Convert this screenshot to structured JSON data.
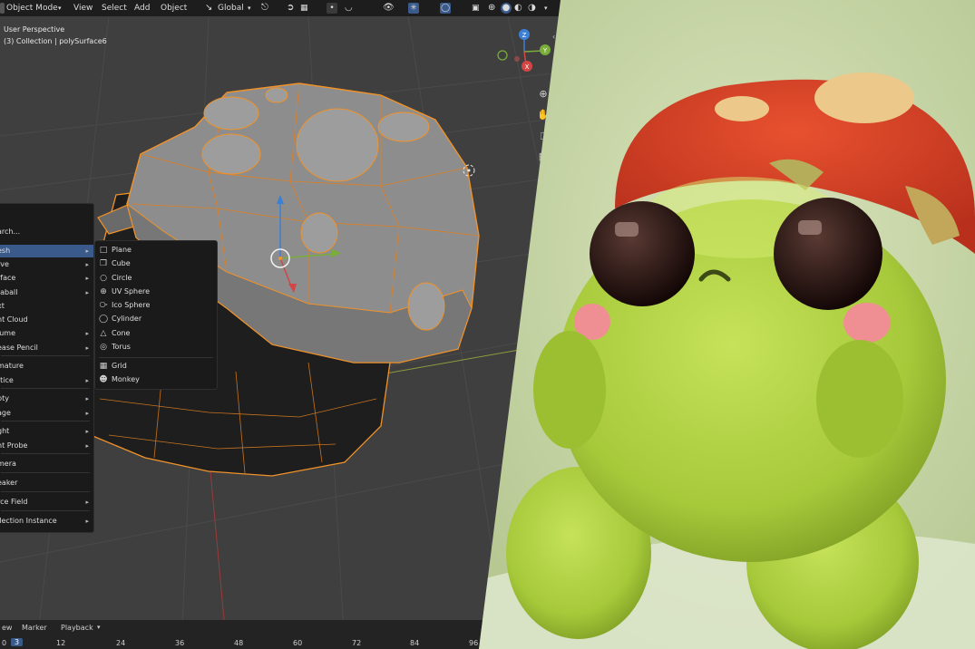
{
  "header": {
    "mode_label": "Object Mode",
    "menu": [
      "View",
      "Select",
      "Add",
      "Object"
    ],
    "transform_orientation": "Global"
  },
  "viewport": {
    "view_name": "User Perspective",
    "collection_info": "(3) Collection | polySurface6"
  },
  "gizmo": {
    "z": "Z",
    "y": "Y",
    "x": "X"
  },
  "add_menu": {
    "items": [
      "arch...",
      "esh",
      "rve",
      "rface",
      "taball",
      "xt",
      "nt Cloud",
      "lume",
      "ease Pencil",
      "mature",
      "ttice",
      "pty",
      "age",
      "ght",
      "ht Probe",
      "mera",
      "eaker",
      "rce Field",
      "llection Instance"
    ]
  },
  "mesh_submenu": {
    "items": [
      {
        "label": "Plane",
        "icon": "plane-icon"
      },
      {
        "label": "Cube",
        "icon": "cube-icon"
      },
      {
        "label": "Circle",
        "icon": "circle-icon"
      },
      {
        "label": "UV Sphere",
        "icon": "uv-sphere-icon"
      },
      {
        "label": "Ico Sphere",
        "icon": "ico-sphere-icon"
      },
      {
        "label": "Cylinder",
        "icon": "cylinder-icon"
      },
      {
        "label": "Cone",
        "icon": "cone-icon"
      },
      {
        "label": "Torus",
        "icon": "torus-icon"
      },
      {
        "label": "Grid",
        "icon": "grid-icon"
      },
      {
        "label": "Monkey",
        "icon": "monkey-icon"
      }
    ]
  },
  "timeline": {
    "menu": [
      "ew",
      "Marker",
      "Playback"
    ],
    "current_frame": "3",
    "start_frame": "0",
    "ticks": [
      "12",
      "24",
      "36",
      "48",
      "60",
      "72",
      "84",
      "96"
    ]
  },
  "colors": {
    "accent": "#3a5a8c",
    "selection_outline": "#f0922a",
    "viewport_bg": "#3f3f3f",
    "render_bg": "#c8d7a8"
  }
}
